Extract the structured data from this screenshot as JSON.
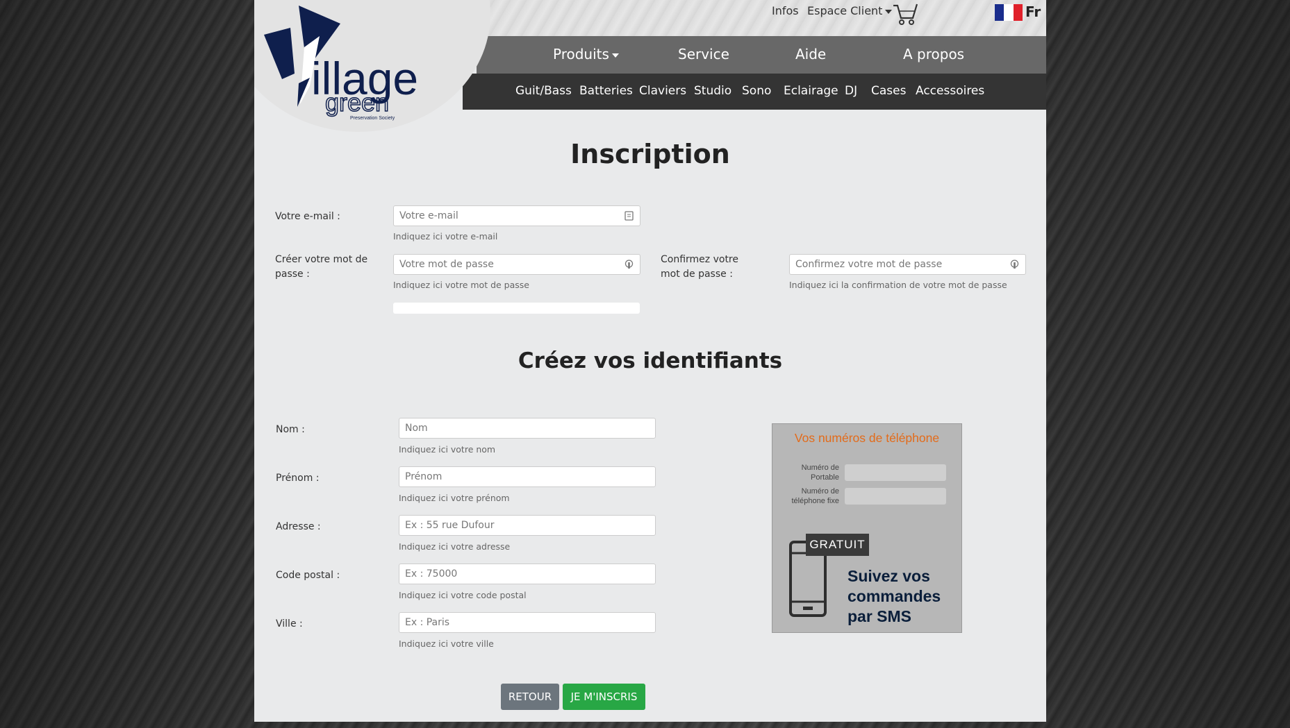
{
  "topbar": {
    "infos": "Infos",
    "espace_client": "Espace Client",
    "lang": "Fr"
  },
  "logo": {
    "brand": "illage",
    "brand2": "green",
    "tagline": "Preservation Society"
  },
  "main_nav": [
    "Produits",
    "Service",
    "Aide",
    "A propos"
  ],
  "sub_nav": [
    "Guit/Bass",
    "Batteries",
    "Claviers",
    "Studio",
    "Sono",
    "Eclairage",
    "DJ",
    "Cases",
    "Accessoires"
  ],
  "inscription": {
    "title": "Inscription",
    "email": {
      "label": "Votre e-mail :",
      "placeholder": "Votre e-mail",
      "hint": "Indiquez ici votre e-mail"
    },
    "password": {
      "label": "Créer votre mot de passe :",
      "placeholder": "Votre mot de passe",
      "hint": "Indiquez ici votre mot de passe"
    },
    "confirm": {
      "label": "Confirmez votre mot de passe :",
      "placeholder": "Confirmez votre mot de passe",
      "hint": "Indiquez ici la confirmation de votre mot de passe"
    }
  },
  "identifiants": {
    "title": "Créez vos identifiants",
    "nom": {
      "label": "Nom :",
      "placeholder": "Nom",
      "hint": "Indiquez ici votre nom"
    },
    "prenom": {
      "label": "Prénom :",
      "placeholder": "Prénom",
      "hint": "Indiquez ici votre prénom"
    },
    "adresse": {
      "label": "Adresse :",
      "placeholder": "Ex : 55 rue Dufour",
      "hint": "Indiquez ici votre adresse"
    },
    "cp": {
      "label": "Code postal :",
      "placeholder": "Ex : 75000",
      "hint": "Indiquez ici votre code postal"
    },
    "ville": {
      "label": "Ville :",
      "placeholder": "Ex : Paris",
      "hint": "Indiquez ici votre ville"
    }
  },
  "sms": {
    "title": "Vos numéros de téléphone",
    "portable_label": "Numéro de Portable",
    "fixe_label": "Numéro de téléphone fixe",
    "badge": "GRATUIT",
    "promo_line1": "Suivez vos",
    "promo_line2": "commandes",
    "promo_line3": "par SMS"
  },
  "buttons": {
    "back": "RETOUR",
    "submit": "JE M'INSCRIS"
  },
  "colors": {
    "submit": "#28a745",
    "back": "#6c757d",
    "nav": "#686868",
    "subnav": "#343434",
    "sms_title": "#e36b1a"
  }
}
